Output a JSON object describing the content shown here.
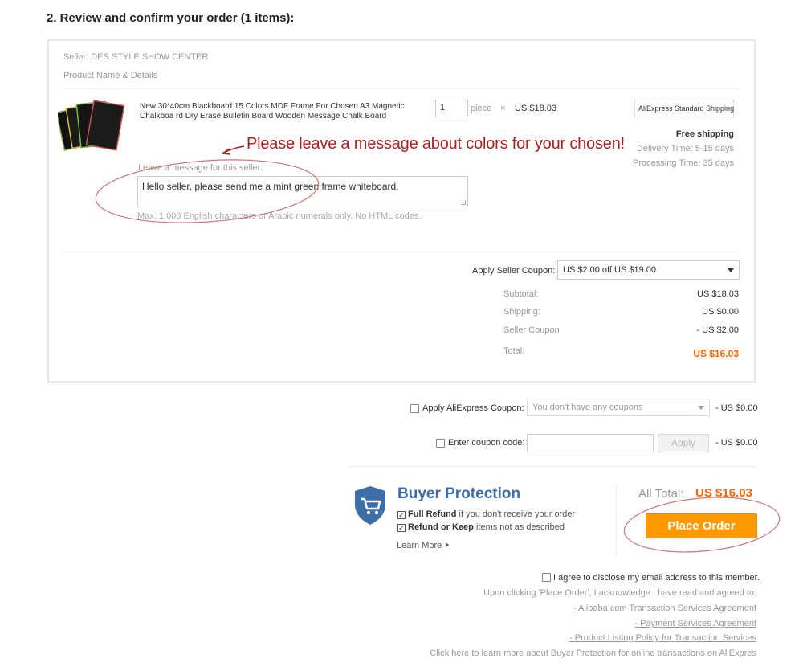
{
  "section_title": "2. Review and confirm your order (1 items):",
  "seller_line": "Seller: DES STYLE SHOW CENTER",
  "product_header": "Product Name & Details",
  "product": {
    "name": "New 30*40cm Blackboard 15 Colors MDF Frame For Chosen A3 Magnetic Chalkboa rd Dry Erase Bulletin Board Wooden Message Chalk Board",
    "quantity": "1",
    "quantity_unit": "piece",
    "times": "×",
    "unit_price": "US $18.03",
    "shipping_method": "AliExpress Standard Shipping",
    "free_shipping": "Free shipping",
    "delivery_time": "Delivery Time:  5-15 days",
    "processing_time": "Processing Time:  35 days"
  },
  "annotation_text": "Please leave a message about colors for your chosen!",
  "message": {
    "label": "Leave a message for this seller:",
    "value": "Hello seller, please send me a mint green frame whiteboard.",
    "help": "Max. 1,000 English characters or Arabic numerals only. No HTML codes."
  },
  "seller_coupon": {
    "label": "Apply Seller Coupon:",
    "selected": "US $2.00 off US $19.00"
  },
  "summary": {
    "subtotal_label": "Subtotal:",
    "subtotal_value": "US $18.03",
    "shipping_label": "Shipping:",
    "shipping_value": "US $0.00",
    "coupon_label": "Seller Coupon",
    "coupon_value": "- US $2.00",
    "total_label": "Total:",
    "total_value": "US $16.03"
  },
  "aliexpress_coupon": {
    "label": "Apply AliExpress Coupon:",
    "placeholder": "You don't have any coupons",
    "value": "- US $0.00"
  },
  "coupon_code": {
    "label": "Enter coupon code:",
    "apply_label": "Apply",
    "value": "- US $0.00"
  },
  "buyer_protection": {
    "title": "Buyer Protection",
    "line1_bold": "Full Refund",
    "line1_rest": " if you don't receive your order",
    "line2_bold": "Refund or Keep",
    "line2_rest": " items not as described",
    "learn_more": "Learn More"
  },
  "all_total": {
    "label": "All Total:",
    "value": "US $16.03"
  },
  "place_order_label": "Place Order",
  "agreement": {
    "checkbox_label": "I agree to disclose my email address to this member.",
    "ack": "Upon clicking 'Place Order', I acknowledge I have read and agreed to:",
    "link1": "- Alibaba.com Transaction Services Agreement",
    "link2": "- Payment Services Agreement",
    "link3": "- Product Listing Policy for Transaction Services",
    "click_here": "Click here",
    "click_here_rest": " to learn more about Buyer Protection for online transactions on AliExpres"
  },
  "colors": {
    "accent_orange": "#ff9900",
    "price_orange": "#ff6600",
    "protection_blue": "#3d6ea8",
    "annotation_red": "#aa2222"
  }
}
